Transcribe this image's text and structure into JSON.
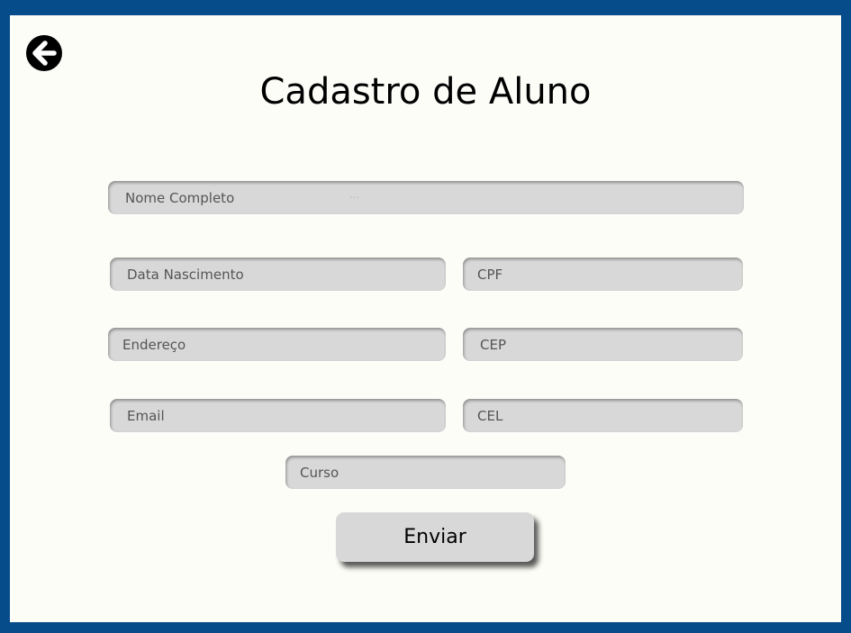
{
  "header": {
    "title": "Cadastro de Aluno",
    "back_icon": "arrow-left-circle-icon"
  },
  "form": {
    "nome_completo": {
      "placeholder": "Nome Completo",
      "hint": "..."
    },
    "data_nascimento": {
      "placeholder": "Data Nascimento"
    },
    "cpf": {
      "placeholder": "CPF"
    },
    "endereco": {
      "placeholder": "Endereço"
    },
    "cep": {
      "placeholder": "CEP"
    },
    "email": {
      "placeholder": "Email"
    },
    "cel": {
      "placeholder": "CEL"
    },
    "curso": {
      "placeholder": "Curso"
    },
    "submit_label": "Enviar"
  },
  "colors": {
    "border": "#064c8a",
    "background": "#fdfdf8",
    "field": "#d8d8d8"
  }
}
